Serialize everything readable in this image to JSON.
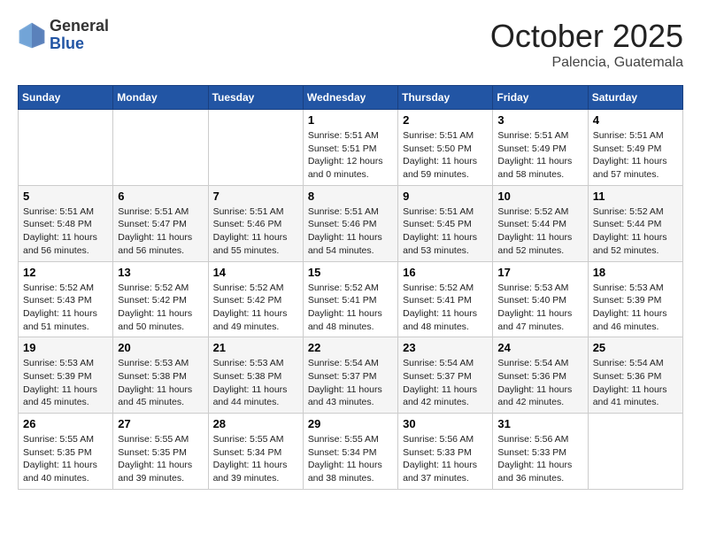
{
  "header": {
    "logo_general": "General",
    "logo_blue": "Blue",
    "month_title": "October 2025",
    "location": "Palencia, Guatemala"
  },
  "weekdays": [
    "Sunday",
    "Monday",
    "Tuesday",
    "Wednesday",
    "Thursday",
    "Friday",
    "Saturday"
  ],
  "weeks": [
    [
      {
        "day": "",
        "content": ""
      },
      {
        "day": "",
        "content": ""
      },
      {
        "day": "",
        "content": ""
      },
      {
        "day": "1",
        "content": "Sunrise: 5:51 AM\nSunset: 5:51 PM\nDaylight: 12 hours\nand 0 minutes."
      },
      {
        "day": "2",
        "content": "Sunrise: 5:51 AM\nSunset: 5:50 PM\nDaylight: 11 hours\nand 59 minutes."
      },
      {
        "day": "3",
        "content": "Sunrise: 5:51 AM\nSunset: 5:49 PM\nDaylight: 11 hours\nand 58 minutes."
      },
      {
        "day": "4",
        "content": "Sunrise: 5:51 AM\nSunset: 5:49 PM\nDaylight: 11 hours\nand 57 minutes."
      }
    ],
    [
      {
        "day": "5",
        "content": "Sunrise: 5:51 AM\nSunset: 5:48 PM\nDaylight: 11 hours\nand 56 minutes."
      },
      {
        "day": "6",
        "content": "Sunrise: 5:51 AM\nSunset: 5:47 PM\nDaylight: 11 hours\nand 56 minutes."
      },
      {
        "day": "7",
        "content": "Sunrise: 5:51 AM\nSunset: 5:46 PM\nDaylight: 11 hours\nand 55 minutes."
      },
      {
        "day": "8",
        "content": "Sunrise: 5:51 AM\nSunset: 5:46 PM\nDaylight: 11 hours\nand 54 minutes."
      },
      {
        "day": "9",
        "content": "Sunrise: 5:51 AM\nSunset: 5:45 PM\nDaylight: 11 hours\nand 53 minutes."
      },
      {
        "day": "10",
        "content": "Sunrise: 5:52 AM\nSunset: 5:44 PM\nDaylight: 11 hours\nand 52 minutes."
      },
      {
        "day": "11",
        "content": "Sunrise: 5:52 AM\nSunset: 5:44 PM\nDaylight: 11 hours\nand 52 minutes."
      }
    ],
    [
      {
        "day": "12",
        "content": "Sunrise: 5:52 AM\nSunset: 5:43 PM\nDaylight: 11 hours\nand 51 minutes."
      },
      {
        "day": "13",
        "content": "Sunrise: 5:52 AM\nSunset: 5:42 PM\nDaylight: 11 hours\nand 50 minutes."
      },
      {
        "day": "14",
        "content": "Sunrise: 5:52 AM\nSunset: 5:42 PM\nDaylight: 11 hours\nand 49 minutes."
      },
      {
        "day": "15",
        "content": "Sunrise: 5:52 AM\nSunset: 5:41 PM\nDaylight: 11 hours\nand 48 minutes."
      },
      {
        "day": "16",
        "content": "Sunrise: 5:52 AM\nSunset: 5:41 PM\nDaylight: 11 hours\nand 48 minutes."
      },
      {
        "day": "17",
        "content": "Sunrise: 5:53 AM\nSunset: 5:40 PM\nDaylight: 11 hours\nand 47 minutes."
      },
      {
        "day": "18",
        "content": "Sunrise: 5:53 AM\nSunset: 5:39 PM\nDaylight: 11 hours\nand 46 minutes."
      }
    ],
    [
      {
        "day": "19",
        "content": "Sunrise: 5:53 AM\nSunset: 5:39 PM\nDaylight: 11 hours\nand 45 minutes."
      },
      {
        "day": "20",
        "content": "Sunrise: 5:53 AM\nSunset: 5:38 PM\nDaylight: 11 hours\nand 45 minutes."
      },
      {
        "day": "21",
        "content": "Sunrise: 5:53 AM\nSunset: 5:38 PM\nDaylight: 11 hours\nand 44 minutes."
      },
      {
        "day": "22",
        "content": "Sunrise: 5:54 AM\nSunset: 5:37 PM\nDaylight: 11 hours\nand 43 minutes."
      },
      {
        "day": "23",
        "content": "Sunrise: 5:54 AM\nSunset: 5:37 PM\nDaylight: 11 hours\nand 42 minutes."
      },
      {
        "day": "24",
        "content": "Sunrise: 5:54 AM\nSunset: 5:36 PM\nDaylight: 11 hours\nand 42 minutes."
      },
      {
        "day": "25",
        "content": "Sunrise: 5:54 AM\nSunset: 5:36 PM\nDaylight: 11 hours\nand 41 minutes."
      }
    ],
    [
      {
        "day": "26",
        "content": "Sunrise: 5:55 AM\nSunset: 5:35 PM\nDaylight: 11 hours\nand 40 minutes."
      },
      {
        "day": "27",
        "content": "Sunrise: 5:55 AM\nSunset: 5:35 PM\nDaylight: 11 hours\nand 39 minutes."
      },
      {
        "day": "28",
        "content": "Sunrise: 5:55 AM\nSunset: 5:34 PM\nDaylight: 11 hours\nand 39 minutes."
      },
      {
        "day": "29",
        "content": "Sunrise: 5:55 AM\nSunset: 5:34 PM\nDaylight: 11 hours\nand 38 minutes."
      },
      {
        "day": "30",
        "content": "Sunrise: 5:56 AM\nSunset: 5:33 PM\nDaylight: 11 hours\nand 37 minutes."
      },
      {
        "day": "31",
        "content": "Sunrise: 5:56 AM\nSunset: 5:33 PM\nDaylight: 11 hours\nand 36 minutes."
      },
      {
        "day": "",
        "content": ""
      }
    ]
  ]
}
